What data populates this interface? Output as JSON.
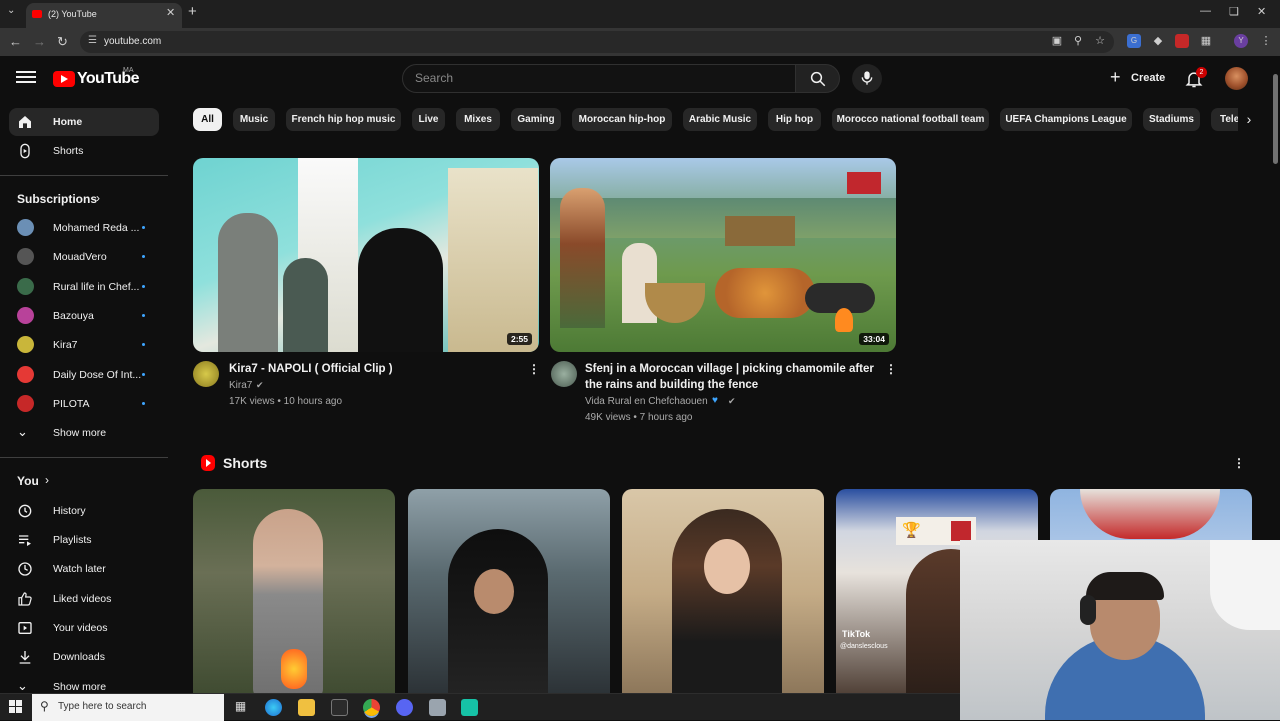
{
  "browser": {
    "tab_title": "(2) YouTube",
    "url": "youtube.com"
  },
  "header": {
    "logo_text": "YouTube",
    "country_code": "MA",
    "search_placeholder": "Search",
    "create_label": "Create",
    "notification_count": "2"
  },
  "sidebar": {
    "main": [
      {
        "label": "Home",
        "icon": "home-icon",
        "active": true
      },
      {
        "label": "Shorts",
        "icon": "shorts-icon"
      }
    ],
    "subscriptions_title": "Subscriptions",
    "subscriptions": [
      {
        "label": "Mohamed Reda ...",
        "color": "#6b8fb5"
      },
      {
        "label": "MouadVero",
        "color": "#555555"
      },
      {
        "label": "Rural life in Chef...",
        "color": "#3a6b4a"
      },
      {
        "label": "Bazouya",
        "color": "#b8429a"
      },
      {
        "label": "Kira7",
        "color": "#c9b63a"
      },
      {
        "label": "Daily Dose Of Int...",
        "color": "#e53935"
      },
      {
        "label": "PILOTA",
        "color": "#c62828"
      }
    ],
    "show_more_1": "Show more",
    "you_title": "You",
    "you_items": [
      {
        "label": "History",
        "icon": "history-icon"
      },
      {
        "label": "Playlists",
        "icon": "playlists-icon"
      },
      {
        "label": "Watch later",
        "icon": "clock-icon"
      },
      {
        "label": "Liked videos",
        "icon": "thumbs-up-icon"
      },
      {
        "label": "Your videos",
        "icon": "play-square-icon"
      },
      {
        "label": "Downloads",
        "icon": "download-icon"
      }
    ],
    "show_more_2": "Show more"
  },
  "chips": [
    "All",
    "Music",
    "French hip hop music",
    "Live",
    "Mixes",
    "Gaming",
    "Moroccan hip-hop",
    "Arabic Music",
    "Hip hop",
    "Morocco national football team",
    "UEFA Champions League",
    "Stadiums",
    "Tele"
  ],
  "videos": [
    {
      "title": "Kira7 - NAPOLI ( Official Clip )",
      "channel": "Kira7",
      "meta": "17K views • 10 hours ago",
      "duration": "2:55"
    },
    {
      "title": "Sfenj in a Moroccan village | picking chamomile after the rains and building the fence",
      "channel": "Vida Rural en Chefchaouen",
      "meta": "49K views • 7 hours ago",
      "duration": "33:04"
    }
  ],
  "shorts": {
    "title": "Shorts",
    "tiktok_label": "TikTok",
    "tiktok_handle": "@danslesclous"
  },
  "taskbar": {
    "search_placeholder": "Type here to search"
  }
}
